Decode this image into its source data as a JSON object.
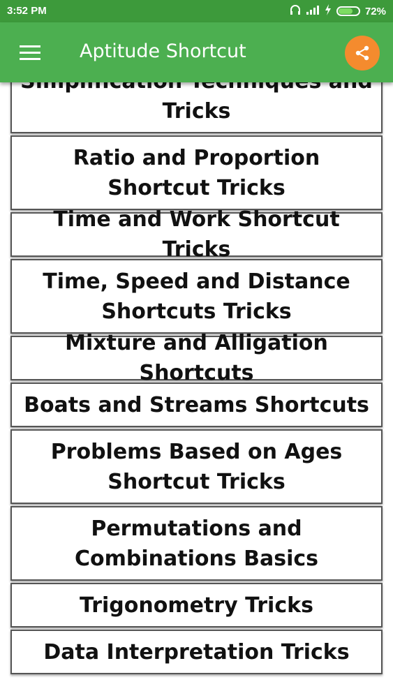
{
  "status_bar": {
    "time": "3:52 PM",
    "battery_percent": "72%",
    "battery_level": 0.72
  },
  "app_bar": {
    "title": "Aptitude Shortcut",
    "share_color": "#f48b2e",
    "bar_color": "#4caf50"
  },
  "topics": [
    "Simplification Techniques and Tricks",
    "Ratio and Proportion Shortcut Tricks",
    "Time and Work Shortcut Tricks",
    "Time, Speed and Distance Shortcuts Tricks",
    "Mixture and Alligation Shortcuts",
    "Boats and Streams Shortcuts",
    "Problems Based on Ages Shortcut Tricks",
    "Permutations and Combinations Basics",
    "Trigonometry Tricks",
    "Data Interpretation Tricks"
  ]
}
